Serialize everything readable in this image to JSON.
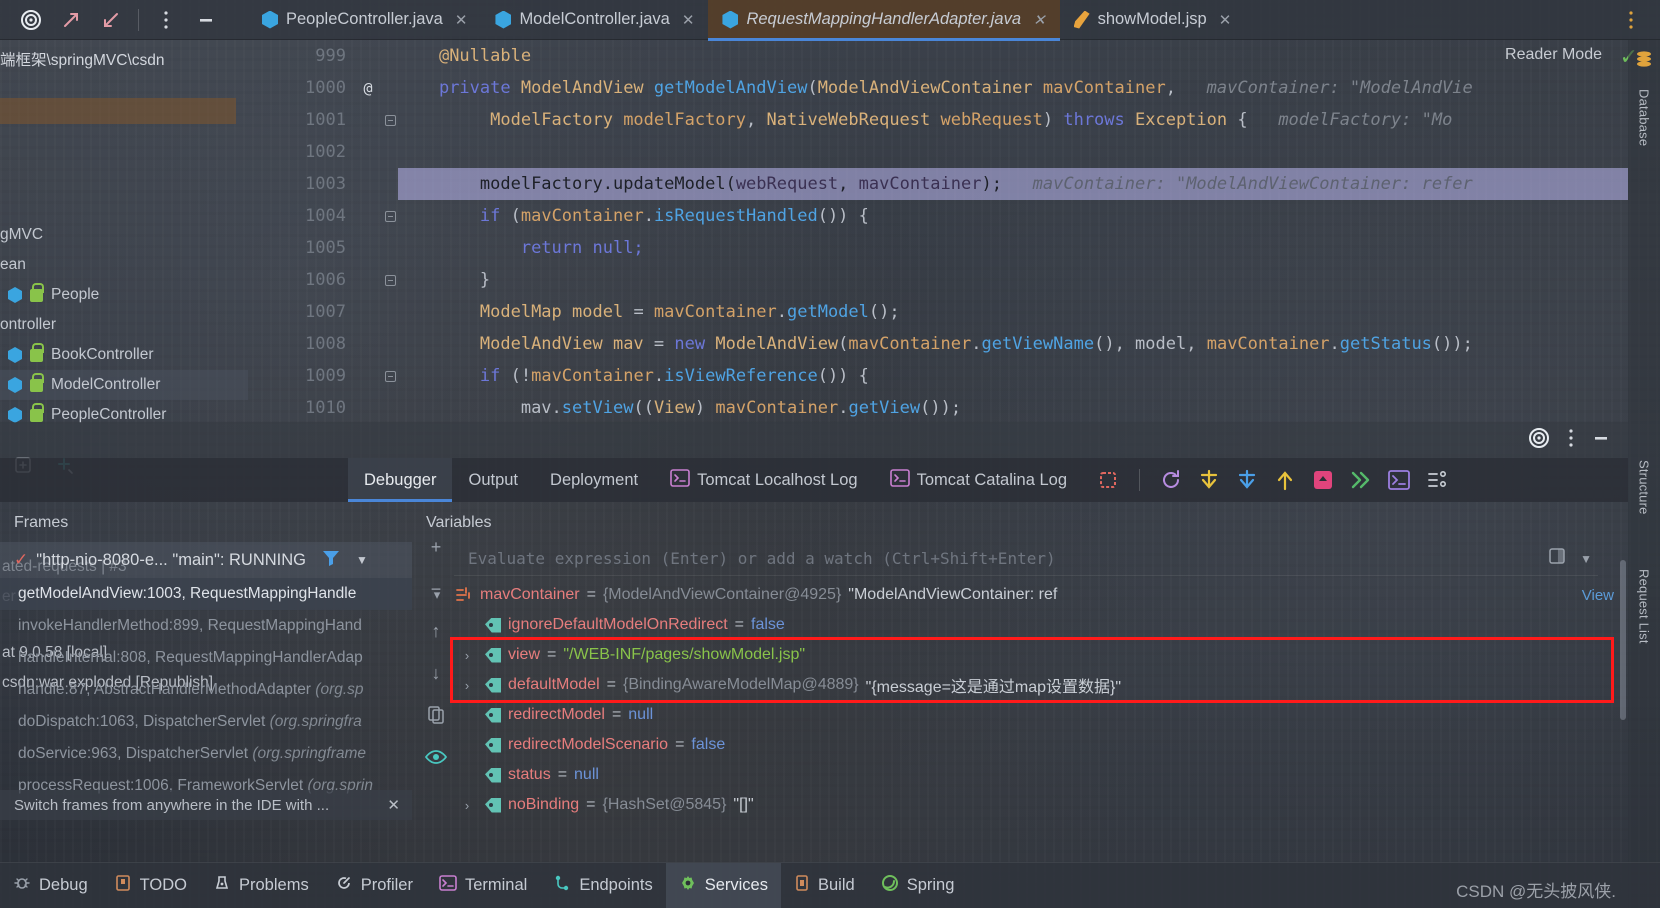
{
  "window": {
    "top_icons": [
      "target-icon",
      "expand-icon",
      "collapse-icon",
      "more-vertical-icon",
      "minimize-icon"
    ],
    "right_rail": [
      "database-label",
      "structure-label",
      "request-list-label"
    ],
    "right_rail_labels": {
      "database": "Database",
      "structure": "Structure",
      "request_list": "Request List"
    }
  },
  "tabs": [
    {
      "label": "PeopleController.java",
      "icon": "java-class-icon",
      "active": false,
      "closable": true
    },
    {
      "label": "ModelController.java",
      "icon": "java-class-icon",
      "active": false,
      "closable": true
    },
    {
      "label": "RequestMappingHandlerAdapter.java",
      "icon": "java-class-icon",
      "active": true,
      "closable": true
    },
    {
      "label": "showModel.jsp",
      "icon": "jsp-file-icon",
      "active": false,
      "closable": true
    }
  ],
  "project_pane": {
    "path": "端框架\\springMVC\\csdn",
    "rows": [
      {
        "label": "gMVC",
        "type": "text"
      },
      {
        "label": "ean",
        "type": "text"
      },
      {
        "label": "People",
        "type": "class"
      },
      {
        "label": "ontroller",
        "type": "text"
      },
      {
        "label": "BookController",
        "type": "class"
      },
      {
        "label": "ModelController",
        "type": "class"
      },
      {
        "label": "PeopleController",
        "type": "class"
      }
    ]
  },
  "editor": {
    "reader_mode_label": "Reader Mode",
    "reader_mode_checked": true,
    "lines": [
      {
        "num": "999",
        "annot": "",
        "fold": false,
        "highlight": false,
        "indent": 4,
        "tokens": [
          {
            "t": "@Nullable",
            "c": "a"
          }
        ]
      },
      {
        "num": "1000",
        "annot": "@",
        "fold": false,
        "highlight": false,
        "indent": 4,
        "tokens": [
          {
            "t": "private ",
            "c": "k"
          },
          {
            "t": "ModelAndView ",
            "c": "t"
          },
          {
            "t": "getModelAndView",
            "c": "m"
          },
          {
            "t": "(",
            "c": "p"
          },
          {
            "t": "ModelAndViewContainer ",
            "c": "t"
          },
          {
            "t": "mavContainer",
            "c": "v"
          },
          {
            "t": ",",
            "c": "p"
          },
          {
            "t": "   mavContainer: \"ModelAndVie",
            "c": "hint"
          }
        ]
      },
      {
        "num": "1001",
        "annot": "",
        "fold": true,
        "highlight": false,
        "indent": 9,
        "tokens": [
          {
            "t": "ModelFactory ",
            "c": "t"
          },
          {
            "t": "modelFactory",
            "c": "v"
          },
          {
            "t": ", ",
            "c": "p"
          },
          {
            "t": "NativeWebRequest ",
            "c": "t"
          },
          {
            "t": "webRequest",
            "c": "v"
          },
          {
            "t": ") ",
            "c": "p"
          },
          {
            "t": "throws ",
            "c": "k"
          },
          {
            "t": "Exception ",
            "c": "t"
          },
          {
            "t": "{",
            "c": "p"
          },
          {
            "t": "   modelFactory: \"Mo",
            "c": "hint"
          }
        ]
      },
      {
        "num": "1002",
        "annot": "",
        "fold": false,
        "highlight": false,
        "indent": 0,
        "tokens": []
      },
      {
        "num": "1003",
        "annot": "",
        "fold": false,
        "highlight": true,
        "indent": 8,
        "tokens": [
          {
            "t": "modelFactory",
            "c": "p"
          },
          {
            "t": ".",
            "c": "p"
          },
          {
            "t": "updateModel",
            "c": "p"
          },
          {
            "t": "(",
            "c": "p"
          },
          {
            "t": "webRequest",
            "c": "v"
          },
          {
            "t": ", ",
            "c": "p"
          },
          {
            "t": "mavContainer",
            "c": "v"
          },
          {
            "t": ");",
            "c": "p"
          },
          {
            "t": "   mavContainer: \"ModelAndViewContainer: refer",
            "c": "hint"
          }
        ]
      },
      {
        "num": "1004",
        "annot": "",
        "fold": true,
        "highlight": false,
        "indent": 8,
        "tokens": [
          {
            "t": "if ",
            "c": "k"
          },
          {
            "t": "(",
            "c": "p"
          },
          {
            "t": "mavContainer",
            "c": "v"
          },
          {
            "t": ".",
            "c": "p"
          },
          {
            "t": "isRequestHandled",
            "c": "m"
          },
          {
            "t": "()) {",
            "c": "p"
          }
        ]
      },
      {
        "num": "1005",
        "annot": "",
        "fold": false,
        "highlight": false,
        "indent": 12,
        "tokens": [
          {
            "t": "return ",
            "c": "k"
          },
          {
            "t": "null;",
            "c": "k"
          }
        ]
      },
      {
        "num": "1006",
        "annot": "",
        "fold": true,
        "highlight": false,
        "indent": 8,
        "tokens": [
          {
            "t": "}",
            "c": "p"
          }
        ]
      },
      {
        "num": "1007",
        "annot": "",
        "fold": false,
        "highlight": false,
        "indent": 8,
        "tokens": [
          {
            "t": "ModelMap ",
            "c": "t"
          },
          {
            "t": "model ",
            "c": "t"
          },
          {
            "t": "= ",
            "c": "p"
          },
          {
            "t": "mavContainer",
            "c": "v"
          },
          {
            "t": ".",
            "c": "p"
          },
          {
            "t": "getModel",
            "c": "m"
          },
          {
            "t": "();",
            "c": "p"
          }
        ]
      },
      {
        "num": "1008",
        "annot": "",
        "fold": false,
        "highlight": false,
        "indent": 8,
        "tokens": [
          {
            "t": "ModelAndView ",
            "c": "t"
          },
          {
            "t": "mav ",
            "c": "t"
          },
          {
            "t": "= ",
            "c": "p"
          },
          {
            "t": "new ",
            "c": "k"
          },
          {
            "t": "ModelAndView",
            "c": "t"
          },
          {
            "t": "(",
            "c": "p"
          },
          {
            "t": "mavContainer",
            "c": "v"
          },
          {
            "t": ".",
            "c": "p"
          },
          {
            "t": "getViewName",
            "c": "m"
          },
          {
            "t": "(), ",
            "c": "p"
          },
          {
            "t": "model",
            "c": "p"
          },
          {
            "t": ", ",
            "c": "p"
          },
          {
            "t": "mavContainer",
            "c": "v"
          },
          {
            "t": ".",
            "c": "p"
          },
          {
            "t": "getStatus",
            "c": "m"
          },
          {
            "t": "());",
            "c": "p"
          }
        ]
      },
      {
        "num": "1009",
        "annot": "",
        "fold": true,
        "highlight": false,
        "indent": 8,
        "tokens": [
          {
            "t": "if ",
            "c": "k"
          },
          {
            "t": "(!",
            "c": "p"
          },
          {
            "t": "mavContainer",
            "c": "v"
          },
          {
            "t": ".",
            "c": "p"
          },
          {
            "t": "isViewReference",
            "c": "m"
          },
          {
            "t": "()) {",
            "c": "p"
          }
        ]
      },
      {
        "num": "1010",
        "annot": "",
        "fold": false,
        "highlight": false,
        "indent": 12,
        "tokens": [
          {
            "t": "mav",
            "c": "p"
          },
          {
            "t": ".",
            "c": "p"
          },
          {
            "t": "setView",
            "c": "m"
          },
          {
            "t": "((",
            "c": "p"
          },
          {
            "t": "View",
            "c": "t"
          },
          {
            "t": ") ",
            "c": "p"
          },
          {
            "t": "mavContainer",
            "c": "v"
          },
          {
            "t": ".",
            "c": "p"
          },
          {
            "t": "getView",
            "c": "m"
          },
          {
            "t": "());",
            "c": "p"
          }
        ]
      }
    ]
  },
  "tool_window": {
    "tabs": [
      {
        "label": "Debugger",
        "active": true,
        "icon": ""
      },
      {
        "label": "Output",
        "active": false,
        "icon": ""
      },
      {
        "label": "Deployment",
        "active": false,
        "icon": ""
      },
      {
        "label": "Tomcat Localhost Log",
        "active": false,
        "icon": "console-icon"
      },
      {
        "label": "Tomcat Catalina Log",
        "active": false,
        "icon": "console-icon"
      }
    ],
    "actions": [
      "mute-breakpoints-icon",
      "rerun-icon",
      "step-over-icon",
      "step-into-icon",
      "step-out-icon",
      "force-step-into-icon",
      "run-to-cursor-icon",
      "evaluate-expression-icon",
      "threads-view-icon"
    ],
    "frames": {
      "title": "Frames",
      "thread": "\"http-nio-8080-e... \"main\": RUNNING",
      "items": [
        {
          "method": "getModelAndView:1003, RequestMappingHandle",
          "pkg": "",
          "selected": true
        },
        {
          "method": "invokeHandlerMethod:899, RequestMappingHand",
          "pkg": "",
          "selected": false
        },
        {
          "method": "handleInternal:808, RequestMappingHandlerAdap",
          "pkg": "",
          "selected": false
        },
        {
          "method": "handle:87, AbstractHandlerMethodAdapter ",
          "pkg": "(org.sp",
          "selected": false
        },
        {
          "method": "doDispatch:1063, DispatcherServlet ",
          "pkg": "(org.springfra",
          "selected": false
        },
        {
          "method": "doService:963, DispatcherServlet ",
          "pkg": "(org.springframe",
          "selected": false
        },
        {
          "method": "processRequest:1006, FrameworkServlet ",
          "pkg": "(org.sprin",
          "selected": false
        }
      ],
      "hint": "Switch frames from anywhere in the IDE with ...",
      "hint_close": "✕"
    },
    "variables": {
      "title": "Variables",
      "watch_placeholder": "Evaluate expression (Enter) or add a watch (Ctrl+Shift+Enter)",
      "view_link": "View",
      "rows": [
        {
          "indent": 0,
          "arrow": "▾",
          "icon": "object-icon",
          "name": "mavContainer",
          "eq": "=",
          "ref": "{ModelAndViewContainer@4925}",
          "value": "\"ModelAndViewContainer: ref",
          "value_class": "vtext",
          "highlighted": false,
          "has_view_link": true
        },
        {
          "indent": 1,
          "arrow": "",
          "icon": "field-icon",
          "name": "ignoreDefaultModelOnRedirect",
          "eq": "=",
          "ref": "",
          "value": "false",
          "value_class": "vbool",
          "highlighted": false,
          "has_view_link": false
        },
        {
          "indent": 1,
          "arrow": "›",
          "icon": "field-icon",
          "name": "view",
          "eq": "=",
          "ref": "",
          "value": "\"/WEB-INF/pages/showModel.jsp\"",
          "value_class": "vstr",
          "highlighted": true,
          "has_view_link": false
        },
        {
          "indent": 1,
          "arrow": "›",
          "icon": "field-icon",
          "name": "defaultModel",
          "eq": "=",
          "ref": "{BindingAwareModelMap@4889}",
          "value": "\"{message=这是通过map设置数据}\"",
          "value_class": "vtext",
          "highlighted": true,
          "has_view_link": false
        },
        {
          "indent": 1,
          "arrow": "",
          "icon": "field-icon",
          "name": "redirectModel",
          "eq": "=",
          "ref": "",
          "value": "null",
          "value_class": "vnull",
          "highlighted": false,
          "has_view_link": false
        },
        {
          "indent": 1,
          "arrow": "",
          "icon": "field-icon",
          "name": "redirectModelScenario",
          "eq": "=",
          "ref": "",
          "value": "false",
          "value_class": "vbool",
          "highlighted": false,
          "has_view_link": false
        },
        {
          "indent": 1,
          "arrow": "",
          "icon": "field-icon",
          "name": "status",
          "eq": "=",
          "ref": "",
          "value": "null",
          "value_class": "vnull",
          "highlighted": false,
          "has_view_link": false
        },
        {
          "indent": 1,
          "arrow": "›",
          "icon": "field-icon",
          "name": "noBinding",
          "eq": "=",
          "ref": "{HashSet@5845}",
          "value": "\"[]\"",
          "value_class": "vtext",
          "highlighted": false,
          "has_view_link": false
        }
      ],
      "side_actions": [
        "add-watch-icon",
        "remove-watch-icon",
        "move-up-icon",
        "move-down-icon",
        "copy-icon",
        "inspect-icon"
      ]
    }
  },
  "left_overlay": {
    "rows": [
      "ated-requests  | #3",
      "er",
      "at 9.0.58 [local]",
      "csdn:war exploded [Republish]"
    ]
  },
  "status_bar": {
    "items": [
      {
        "label": "Debug",
        "icon": "debug-icon",
        "active": false
      },
      {
        "label": "TODO",
        "icon": "todo-icon",
        "active": false
      },
      {
        "label": "Problems",
        "icon": "problems-icon",
        "active": false
      },
      {
        "label": "Profiler",
        "icon": "profiler-icon",
        "active": false
      },
      {
        "label": "Terminal",
        "icon": "terminal-icon",
        "active": false
      },
      {
        "label": "Endpoints",
        "icon": "endpoints-icon",
        "active": false
      },
      {
        "label": "Services",
        "icon": "services-icon",
        "active": true
      },
      {
        "label": "Build",
        "icon": "build-icon",
        "active": false
      },
      {
        "label": "Spring",
        "icon": "spring-icon",
        "active": false
      }
    ]
  },
  "watermark": "CSDN @无头披风侠.",
  "colors": {
    "accent_blue": "#4a86d8",
    "active_tab_bg": "#604122",
    "highlight_line": "#bcb8f3",
    "redbox": "#ff1a1a",
    "string_green": "#89c34a",
    "var_red": "#e77d7d",
    "teal": "#62c3b4"
  }
}
